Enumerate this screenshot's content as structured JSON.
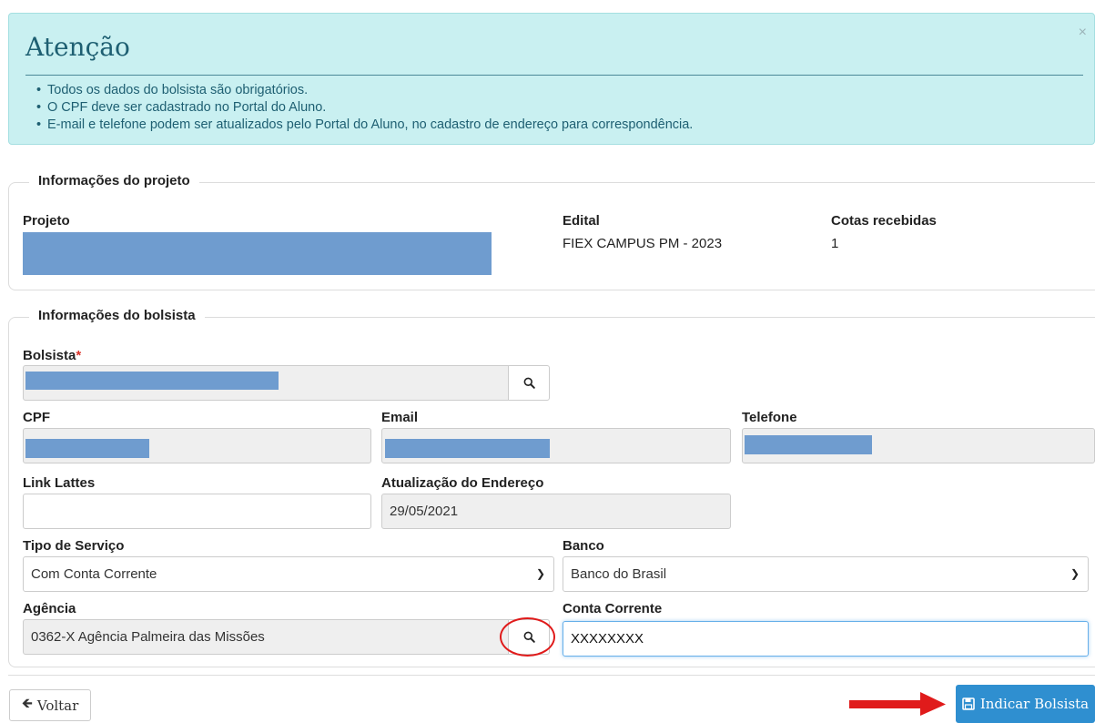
{
  "alert": {
    "title": "Atenção",
    "close": "×",
    "items": [
      "Todos os dados do bolsista são obrigatórios.",
      "O CPF deve ser cadastrado no Portal do Aluno.",
      "E-mail e telefone podem ser atualizados pelo Portal do Aluno, no cadastro de endereço para correspondência."
    ]
  },
  "project": {
    "legend": "Informações do projeto",
    "projeto_label": "Projeto",
    "edital_label": "Edital",
    "edital_value": "FIEX CAMPUS PM - 2023",
    "cotas_label": "Cotas recebidas",
    "cotas_value": "1"
  },
  "bolsista": {
    "legend": "Informações do bolsista",
    "bolsista_label": "Bolsista",
    "required_mark": "*",
    "cpf_label": "CPF",
    "email_label": "Email",
    "telefone_label": "Telefone",
    "lattes_label": "Link Lattes",
    "lattes_value": "",
    "atualizacao_label": "Atualização do Endereço",
    "atualizacao_value": "29/05/2021",
    "tipo_label": "Tipo de Serviço",
    "tipo_value": "Com Conta Corrente",
    "banco_label": "Banco",
    "banco_value": "Banco do Brasil",
    "agencia_label": "Agência",
    "agencia_value": "0362-X Agência Palmeira das Missões",
    "conta_label": "Conta Corrente",
    "conta_value": "XXXXXXXX"
  },
  "footer": {
    "back_label": "Voltar",
    "submit_label": "Indicar Bolsista"
  },
  "colors": {
    "alert_bg": "#c9f0f1",
    "alert_text": "#1e5f72",
    "primary": "#2f8fd0",
    "redaction": "#6f9ccf",
    "highlight": "#e01b1b"
  },
  "icons": {
    "search": "search-icon",
    "back": "arrow-left-icon",
    "save": "floppy-disk-icon",
    "caret": "chevron-down-icon",
    "annotation_arrow": "red-arrow-icon"
  }
}
